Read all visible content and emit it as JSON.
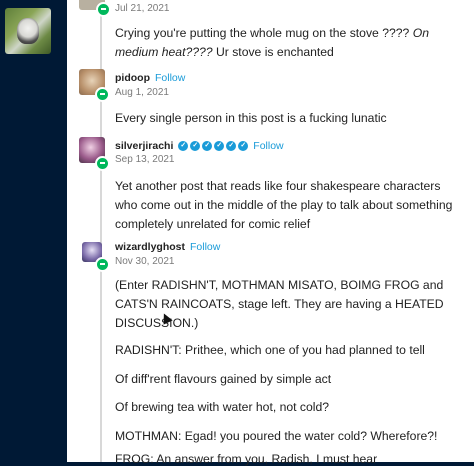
{
  "notes": [
    {
      "date": "Jul 21, 2021",
      "body_plain": "Crying you're putting the whole mug on the stove ???? ",
      "body_italic": "On medium heat????",
      "body_tail": " Ur stove is enchanted"
    },
    {
      "username": "pidoop",
      "follow": "Follow",
      "date": "Aug 1, 2021",
      "body": "Every single person in this post is a fucking lunatic"
    },
    {
      "username": "silverjirachi",
      "follow": "Follow",
      "date": "Sep 13, 2021",
      "verified_badges": 6,
      "body": "Yet another post that reads like four shakespeare characters who come out in the middle of the play to talk about something completely unrelated for comic relief"
    },
    {
      "username": "wizardlyghost",
      "follow": "Follow",
      "date": "Nov 30, 2021",
      "paragraphs": [
        "(Enter RADISHN'T, MOTHMAN MISATO, BOIMG FROG and CATS'N RAINCOATS, stage left. They are having a HEATED DISCUSSION.)",
        "RADISHN'T: Prithee, which one of you had planned to tell",
        "Of diff'rent flavours gained by simple act",
        "Of brewing tea with water hot, not cold?",
        "MOTHMAN: Egad! you poured the water cold? Wherefore?!",
        "FROG: An answer from you, Radish, I must hear"
      ]
    }
  ],
  "colors": {
    "background": "#001935",
    "card": "#ffffff",
    "follow": "#1a9bd8",
    "badge": "#00b85c"
  }
}
